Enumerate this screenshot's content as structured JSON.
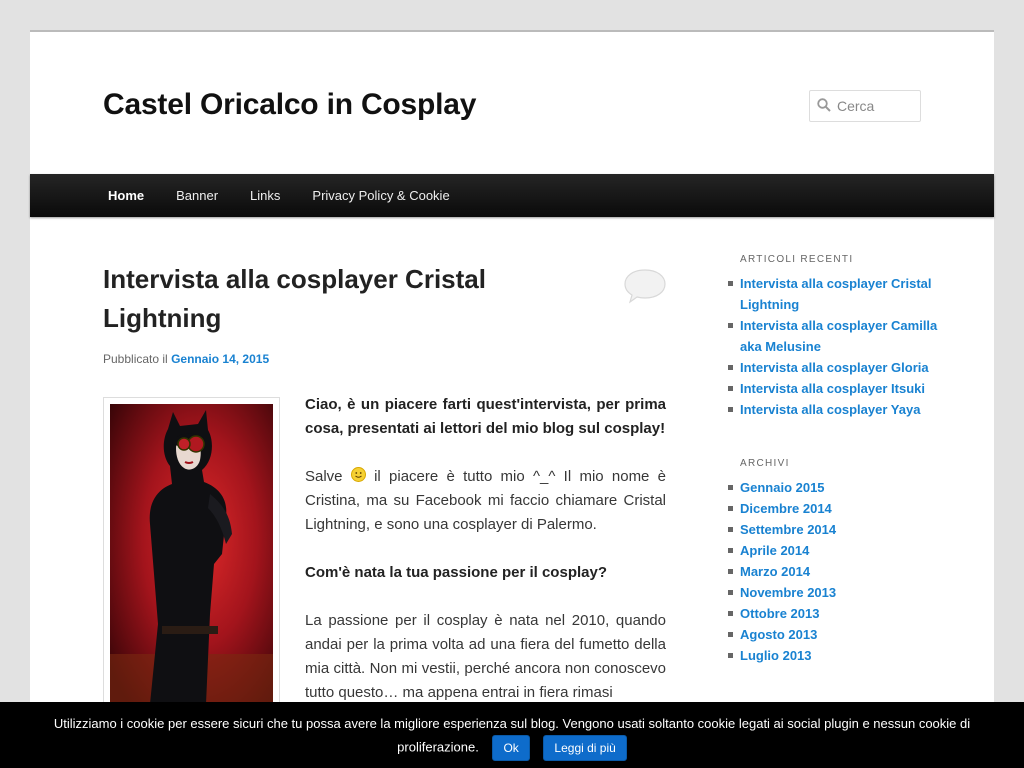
{
  "site": {
    "title": "Castel Oricalco in Cosplay"
  },
  "search": {
    "placeholder": "Cerca",
    "icon": "search-icon"
  },
  "nav": {
    "items": [
      "Home",
      "Banner",
      "Links",
      "Privacy Policy & Cookie"
    ],
    "current": "Home"
  },
  "post": {
    "title": "Intervista alla cosplayer Cristal Lightning",
    "meta_prefix": "Pubblicato il",
    "date": "Gennaio 14, 2015",
    "p1": "Ciao, è un piacere farti quest'intervista, per prima cosa, presentati ai lettori del mio blog sul cosplay!",
    "p2_before": "Salve",
    "p2_after": "il piacere è tutto mio ^_^ Il mio nome è Cristina, ma su Facebook mi faccio chiamare Cristal Lightning, e sono una cosplayer di Palermo.",
    "p3": "Com'è nata la tua passione per il cosplay?",
    "p4": "La passione per il cosplay è nata nel 2010, quando andai per la prima volta ad una fiera del fumetto della mia città. Non mi vestii, perché ancora non conoscevo tutto questo… ma appena entrai in fiera rimasi"
  },
  "sidebar": {
    "recent_title": "Articoli recenti",
    "recent": [
      "Intervista alla cosplayer Cristal Lightning",
      "Intervista alla cosplayer Camilla aka Melusine",
      "Intervista alla cosplayer Gloria",
      "Intervista alla cosplayer Itsuki",
      "Intervista alla cosplayer Yaya"
    ],
    "archive_title": "Archivi",
    "archives": [
      "Gennaio 2015",
      "Dicembre 2014",
      "Settembre 2014",
      "Aprile 2014",
      "Marzo 2014",
      "Novembre 2013",
      "Ottobre 2013",
      "Agosto 2013",
      "Luglio 2013"
    ]
  },
  "cookie": {
    "message": "Utilizziamo i cookie per essere sicuri che tu possa avere la migliore esperienza sul blog. Vengono usati soltanto cookie legati ai social plugin e nessun cookie di proliferazione.",
    "ok": "Ok",
    "more": "Leggi di più"
  },
  "colors": {
    "link": "#1982d1",
    "nav_bg": "#111111",
    "cookie_btn": "#0e6ccb"
  }
}
